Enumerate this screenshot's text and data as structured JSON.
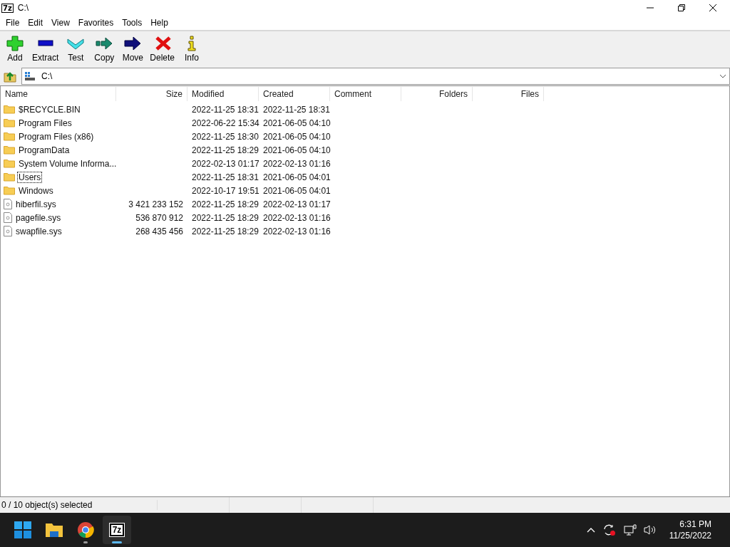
{
  "window": {
    "logo": "7z",
    "title": "C:\\"
  },
  "menu": [
    "File",
    "Edit",
    "View",
    "Favorites",
    "Tools",
    "Help"
  ],
  "toolbar": [
    {
      "kind": "add",
      "label": "Add"
    },
    {
      "kind": "extract",
      "label": "Extract"
    },
    {
      "kind": "test",
      "label": "Test"
    },
    {
      "kind": "copy",
      "label": "Copy"
    },
    {
      "kind": "move",
      "label": "Move"
    },
    {
      "kind": "delete",
      "label": "Delete"
    },
    {
      "kind": "info",
      "label": "Info"
    }
  ],
  "address": {
    "value": "C:\\"
  },
  "table": {
    "columns": [
      "Name",
      "Size",
      "Modified",
      "Created",
      "Comment",
      "Folders",
      "Files"
    ],
    "rows": [
      {
        "kind": "folder",
        "name": "$RECYCLE.BIN",
        "size": "",
        "modified": "2022-11-25 18:31",
        "created": "2022-11-25 18:31",
        "focused": false
      },
      {
        "kind": "folder",
        "name": "Program Files",
        "size": "",
        "modified": "2022-06-22 15:34",
        "created": "2021-06-05 04:10",
        "focused": false
      },
      {
        "kind": "folder",
        "name": "Program Files (x86)",
        "size": "",
        "modified": "2022-11-25 18:30",
        "created": "2021-06-05 04:10",
        "focused": false
      },
      {
        "kind": "folder",
        "name": "ProgramData",
        "size": "",
        "modified": "2022-11-25 18:29",
        "created": "2021-06-05 04:10",
        "focused": false
      },
      {
        "kind": "folder",
        "name": "System Volume Informa...",
        "size": "",
        "modified": "2022-02-13 01:17",
        "created": "2022-02-13 01:16",
        "focused": false
      },
      {
        "kind": "folder",
        "name": "Users",
        "size": "",
        "modified": "2022-11-25 18:31",
        "created": "2021-06-05 04:01",
        "focused": true
      },
      {
        "kind": "folder",
        "name": "Windows",
        "size": "",
        "modified": "2022-10-17 19:51",
        "created": "2021-06-05 04:01",
        "focused": false
      },
      {
        "kind": "file",
        "name": "hiberfil.sys",
        "size": "3 421 233 152",
        "modified": "2022-11-25 18:29",
        "created": "2022-02-13 01:17",
        "focused": false
      },
      {
        "kind": "file",
        "name": "pagefile.sys",
        "size": "536 870 912",
        "modified": "2022-11-25 18:29",
        "created": "2022-02-13 01:16",
        "focused": false
      },
      {
        "kind": "file",
        "name": "swapfile.sys",
        "size": "268 435 456",
        "modified": "2022-11-25 18:29",
        "created": "2022-02-13 01:16",
        "focused": false
      }
    ]
  },
  "status_bar": {
    "text": "0 / 10 object(s) selected"
  },
  "taskbar": {
    "apps": [
      {
        "kind": "start",
        "active": false
      },
      {
        "kind": "explorer",
        "active": false
      },
      {
        "kind": "chrome",
        "active": false
      },
      {
        "kind": "app",
        "logo": "7z",
        "active": true
      }
    ],
    "time": "6:31 PM",
    "date": "11/25/2022"
  }
}
